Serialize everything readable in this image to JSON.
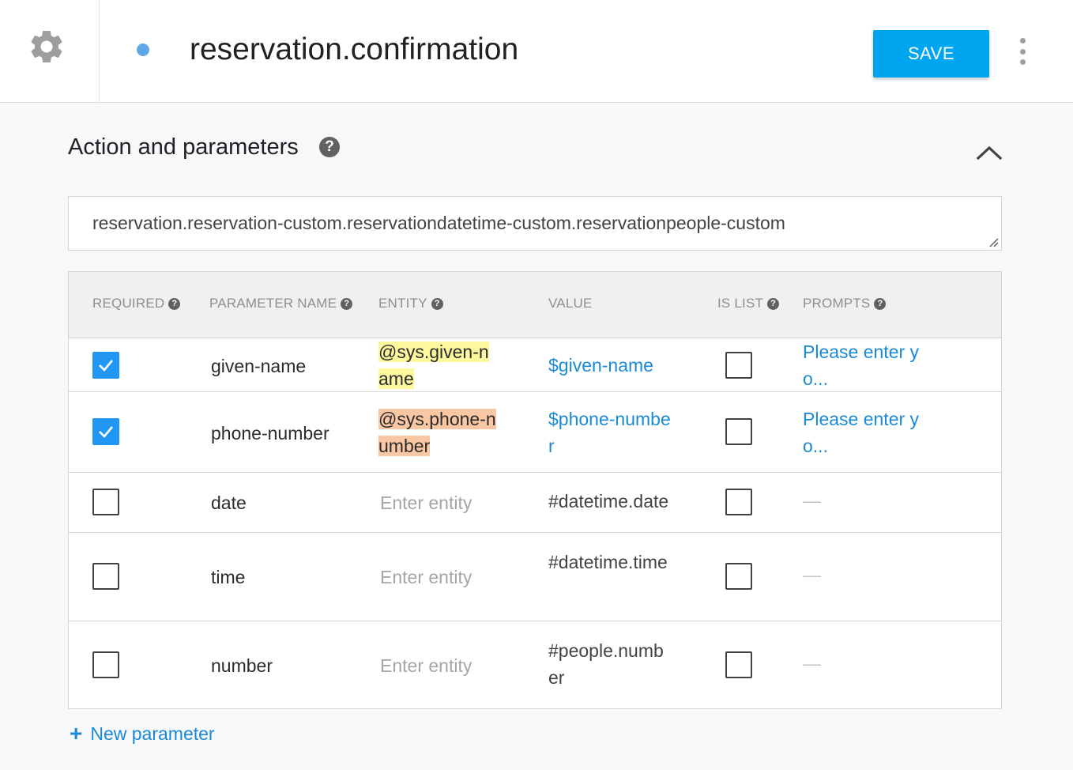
{
  "header": {
    "intent_name": "reservation.confirmation",
    "save_label": "SAVE"
  },
  "section": {
    "title": "Action and parameters",
    "action_value": "reservation.reservation-custom.reservationdatetime-custom.reservationpeople-custom"
  },
  "table": {
    "columns": {
      "required": "REQUIRED",
      "parameter_name": "PARAMETER NAME",
      "entity": "ENTITY",
      "value": "VALUE",
      "is_list": "IS LIST",
      "prompts": "PROMPTS"
    },
    "entity_placeholder": "Enter entity",
    "rows": [
      {
        "required": true,
        "name": "given-name",
        "entity": "@sys.given-name",
        "value": "$given-name",
        "is_list": false,
        "prompt": "Please enter yo..."
      },
      {
        "required": true,
        "name": "phone-number",
        "entity": "@sys.phone-number",
        "value": "$phone-number",
        "is_list": false,
        "prompt": "Please enter yo..."
      },
      {
        "required": false,
        "name": "date",
        "entity": "",
        "value": "#datetime.date",
        "is_list": false,
        "prompt": "—"
      },
      {
        "required": false,
        "name": "time",
        "entity": "",
        "value": "#datetime.time",
        "is_list": false,
        "prompt": "—"
      },
      {
        "required": false,
        "name": "number",
        "entity": "",
        "value": "#people.number",
        "is_list": false,
        "prompt": "—"
      }
    ]
  },
  "footer": {
    "new_parameter_label": "New parameter",
    "plus_symbol": "+"
  },
  "icons": {
    "settings": "gear-icon",
    "status": "status-dot",
    "more": "more-vert-icon",
    "help": "help-icon",
    "collapse": "chevron-up-icon",
    "check": "check-icon"
  },
  "colors": {
    "save_button": "#00a5ef",
    "link": "#1b8ad6",
    "checkbox_checked": "#2196f3",
    "entity_given_name_highlight": "#fdf89e",
    "entity_phone_number_highlight": "#f9c7a3",
    "status_dot": "#5fa8e8"
  }
}
